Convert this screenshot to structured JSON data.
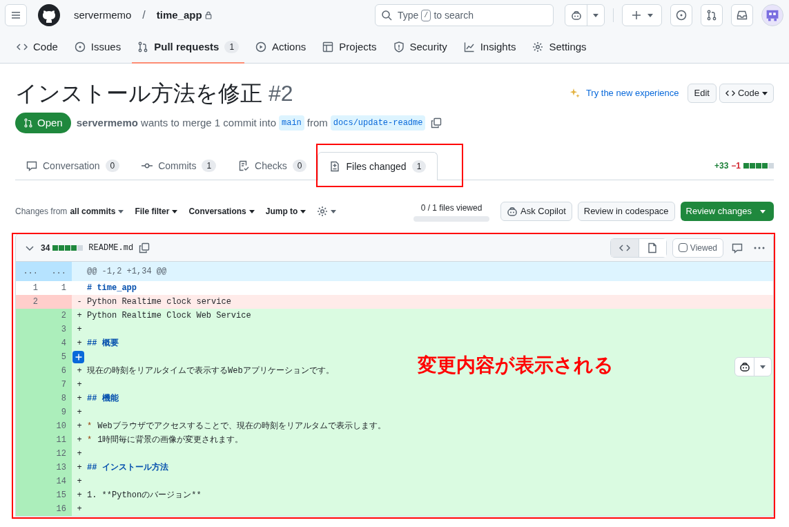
{
  "header": {
    "owner": "servermemo",
    "separator": "/",
    "repo": "time_app",
    "search_placeholder_parts": [
      "Type",
      "/",
      "to search"
    ]
  },
  "repo_nav": [
    {
      "label": "Code",
      "selected": false
    },
    {
      "label": "Issues",
      "selected": false
    },
    {
      "label": "Pull requests",
      "count": "1",
      "selected": true
    },
    {
      "label": "Actions",
      "selected": false
    },
    {
      "label": "Projects",
      "selected": false
    },
    {
      "label": "Security",
      "selected": false
    },
    {
      "label": "Insights",
      "selected": false
    },
    {
      "label": "Settings",
      "selected": false
    }
  ],
  "pr": {
    "title": "インストール方法を修正",
    "number": "#2",
    "try_new": "Try the new experience",
    "edit": "Edit",
    "code": "Code",
    "state": "Open",
    "author": "servermemo",
    "merge_text": "wants to merge 1 commit into",
    "base": "main",
    "from": "from",
    "head": "docs/update-readme"
  },
  "pr_tabs": [
    {
      "label": "Conversation",
      "count": "0",
      "selected": false
    },
    {
      "label": "Commits",
      "count": "1",
      "selected": false
    },
    {
      "label": "Checks",
      "count": "0",
      "selected": false
    },
    {
      "label": "Files changed",
      "count": "1",
      "selected": true
    }
  ],
  "diffstat": {
    "added": "+33",
    "removed": "−1"
  },
  "toolbar": {
    "changes_from": "Changes from",
    "changes_value": "all commits",
    "filters": [
      "File filter",
      "Conversations",
      "Jump to"
    ],
    "files_viewed": "0 / 1 files viewed",
    "viewed_progress": {
      "level": 0
    },
    "ask_copilot": "Ask Copilot",
    "codespace": "Review in codespace",
    "review": "Review changes"
  },
  "file": {
    "count": "34",
    "name": "README.md",
    "viewed_label": "Viewed",
    "viewed": false
  },
  "diff_lines": [
    {
      "kind": "hunk",
      "old": "...",
      "new": "...",
      "text": "@@ -1,2 +1,34 @@"
    },
    {
      "kind": "context-heading",
      "old": "1",
      "new": "1",
      "text": "# time_app"
    },
    {
      "kind": "del",
      "old": "2",
      "sign": "-",
      "text": "Python Realtime clock service"
    },
    {
      "kind": "add",
      "new": "2",
      "sign": "+",
      "text": "Python Realtime Clock Web Service"
    },
    {
      "kind": "add",
      "new": "3",
      "sign": "+"
    },
    {
      "kind": "add-heading",
      "new": "4",
      "sign": "+",
      "text": "## 概要"
    },
    {
      "kind": "add-comment",
      "new": "5"
    },
    {
      "kind": "add",
      "new": "6",
      "sign": "+",
      "text": "現在の時刻をリアルタイムで表示するWebアプリケーションです。"
    },
    {
      "kind": "add",
      "new": "7",
      "sign": "+"
    },
    {
      "kind": "add-heading",
      "new": "8",
      "sign": "+",
      "text": "## 機能"
    },
    {
      "kind": "add",
      "new": "9",
      "sign": "+"
    },
    {
      "kind": "add-bullet",
      "new": "10",
      "sign": "+",
      "marker": "*",
      "text": "Webブラウザでアクセスすることで、現在の時刻をリアルタムで表示します。"
    },
    {
      "kind": "add-bullet",
      "new": "11",
      "sign": "+",
      "marker": "*",
      "text": "1時間毎に背景の画像が変更されます。"
    },
    {
      "kind": "add",
      "new": "12",
      "sign": "+"
    },
    {
      "kind": "add-heading",
      "new": "13",
      "sign": "+",
      "text": "## インストール方法"
    },
    {
      "kind": "add",
      "new": "14",
      "sign": "+"
    },
    {
      "kind": "add",
      "new": "15",
      "sign": "+",
      "text": "1. **Pythonのバージョン**"
    },
    {
      "kind": "add",
      "new": "16",
      "sign": "+"
    }
  ],
  "annotation": {
    "text": "変更内容が表示される"
  }
}
